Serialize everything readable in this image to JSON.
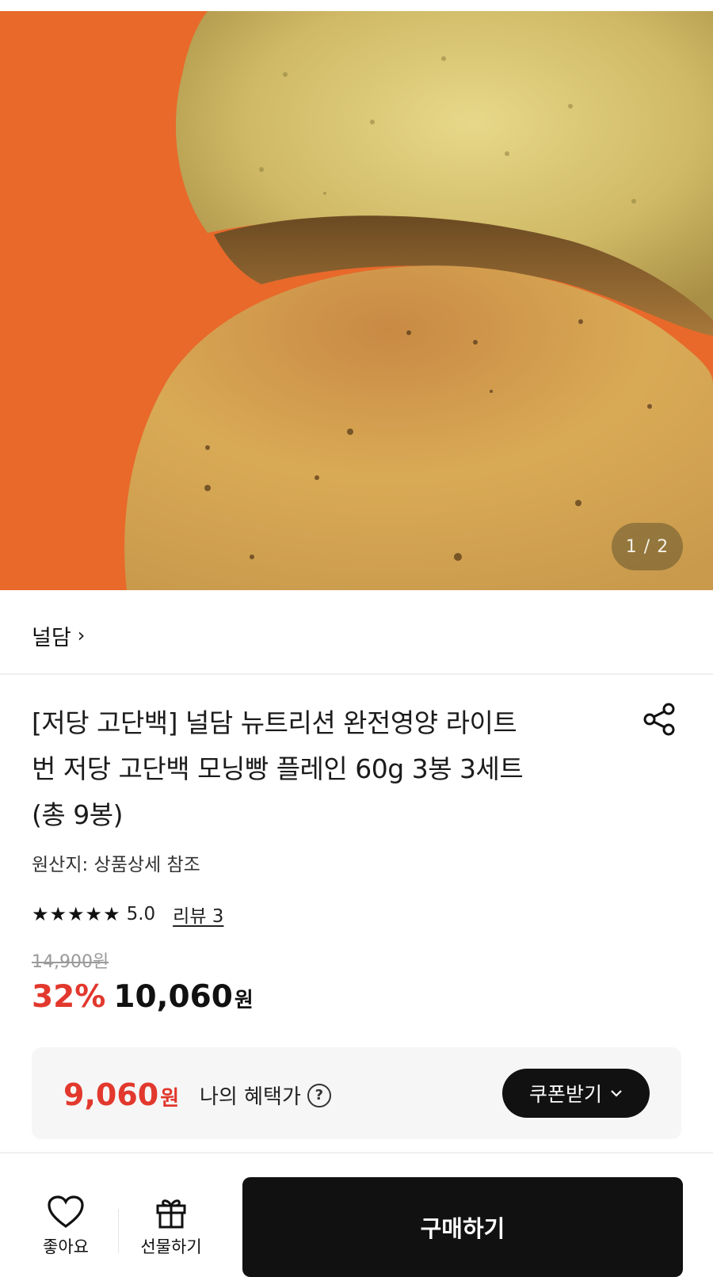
{
  "gallery": {
    "counter": "1 / 2",
    "background_color": "#e8692a"
  },
  "brand": {
    "name": "널담",
    "chevron": "›"
  },
  "product": {
    "title_lines": [
      "[저당 고단백] 널담 뉴트리션 완전영양 라이트",
      "번 저당 고단백 모닝빵 플레인 60g 3봉 3세트",
      "(총 9봉)"
    ],
    "origin": "원산지: 상품상세 참조",
    "rating": "5.0",
    "stars": 5,
    "review_link": "리뷰 3"
  },
  "pricing": {
    "original_price": "14,900원",
    "discount": "32%",
    "price": "10,060",
    "price_unit": "원",
    "accent_color": "#e2382d"
  },
  "benefit": {
    "price": "9,060",
    "unit": "원",
    "label": "나의 혜택가",
    "help": "?",
    "coupon_button": "쿠폰받기"
  },
  "bottom_bar": {
    "like_label": "좋아요",
    "gift_label": "선물하기",
    "buy_label": "구매하기"
  },
  "icons": [
    "share-icon",
    "heart-icon",
    "gift-icon",
    "help-icon",
    "chevron-right-icon",
    "chevron-down-icon",
    "star-icon"
  ]
}
